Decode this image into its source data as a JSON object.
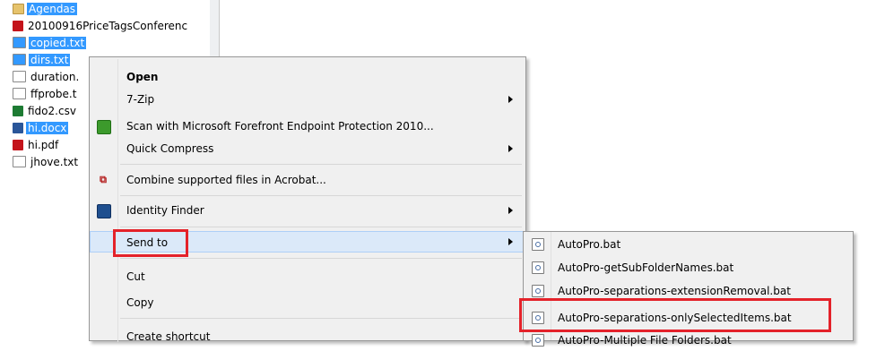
{
  "files": [
    {
      "name": "Agendas",
      "icon": "folder-icon",
      "selected": true
    },
    {
      "name": "20100916PriceTagsConferenc",
      "icon": "pdf-icon",
      "selected": false
    },
    {
      "name": "copied.txt",
      "icon": "text-file-icon",
      "selected": true
    },
    {
      "name": "dirs.txt",
      "icon": "text-file-icon",
      "selected": true
    },
    {
      "name": "duration.",
      "icon": "text-file-icon",
      "selected": false
    },
    {
      "name": "ffprobe.t",
      "icon": "text-file-icon",
      "selected": false
    },
    {
      "name": "fido2.csv",
      "icon": "excel-icon",
      "selected": false
    },
    {
      "name": "hi.docx",
      "icon": "word-icon",
      "selected": true
    },
    {
      "name": "hi.pdf",
      "icon": "pdf-icon",
      "selected": false
    },
    {
      "name": "jhove.txt",
      "icon": "text-file-icon",
      "selected": false
    }
  ],
  "context_menu": {
    "open": "Open",
    "seven_zip": "7-Zip",
    "scan": "Scan with Microsoft Forefront Endpoint Protection 2010...",
    "quick_compress": "Quick Compress",
    "combine_acrobat": "Combine supported files in Acrobat...",
    "identity_finder": "Identity Finder",
    "send_to": "Send to",
    "cut": "Cut",
    "copy": "Copy",
    "create_shortcut": "Create shortcut"
  },
  "send_to_menu": {
    "items": [
      "AutoPro.bat",
      "AutoPro-getSubFolderNames.bat",
      "AutoPro-separations-extensionRemoval.bat",
      "AutoPro-separations-onlySelectedItems.bat",
      "AutoPro-Multiple File Folders.bat"
    ]
  },
  "colors": {
    "selection": "#3399ff",
    "highlight_box": "#e4222a",
    "menu_background": "#f0f0f0"
  }
}
